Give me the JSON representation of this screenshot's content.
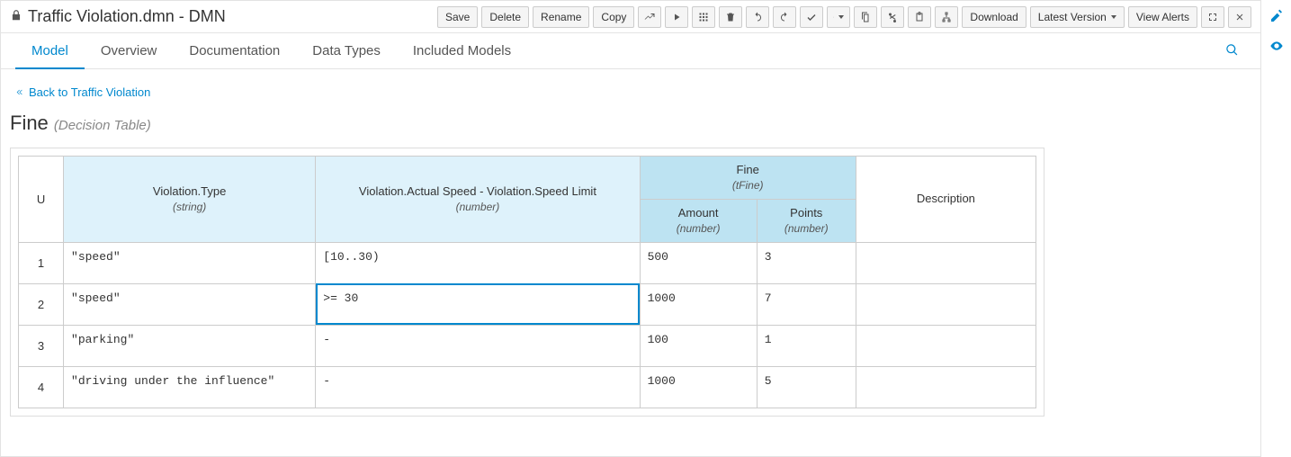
{
  "header": {
    "title": "Traffic Violation.dmn - DMN"
  },
  "toolbar": {
    "save": "Save",
    "delete": "Delete",
    "rename": "Rename",
    "copy": "Copy",
    "download": "Download",
    "latest_version": "Latest Version",
    "view_alerts": "View Alerts"
  },
  "tabs": {
    "model": "Model",
    "overview": "Overview",
    "documentation": "Documentation",
    "data_types": "Data Types",
    "included_models": "Included Models"
  },
  "breadcrumb": {
    "back_label": "Back to Traffic Violation"
  },
  "page": {
    "title": "Fine",
    "subtitle": "(Decision Table)"
  },
  "table": {
    "hit_policy": "U",
    "inputs": [
      {
        "name": "Violation.Type",
        "type": "(string)"
      },
      {
        "name": "Violation.Actual Speed - Violation.Speed Limit",
        "type": "(number)"
      }
    ],
    "output_group": {
      "name": "Fine",
      "type": "(tFine)"
    },
    "outputs": [
      {
        "name": "Amount",
        "type": "(number)"
      },
      {
        "name": "Points",
        "type": "(number)"
      }
    ],
    "annotation": "Description",
    "rows": [
      {
        "n": "1",
        "in": [
          "\"speed\"",
          "[10..30)"
        ],
        "out": [
          "500",
          "3"
        ],
        "anno": ""
      },
      {
        "n": "2",
        "in": [
          "\"speed\"",
          ">= 30"
        ],
        "out": [
          "1000",
          "7"
        ],
        "anno": ""
      },
      {
        "n": "3",
        "in": [
          "\"parking\"",
          "-"
        ],
        "out": [
          "100",
          "1"
        ],
        "anno": ""
      },
      {
        "n": "4",
        "in": [
          "\"driving under the influence\"",
          "-"
        ],
        "out": [
          "1000",
          "5"
        ],
        "anno": ""
      }
    ],
    "selected": {
      "row": 1,
      "col": "in1"
    }
  }
}
